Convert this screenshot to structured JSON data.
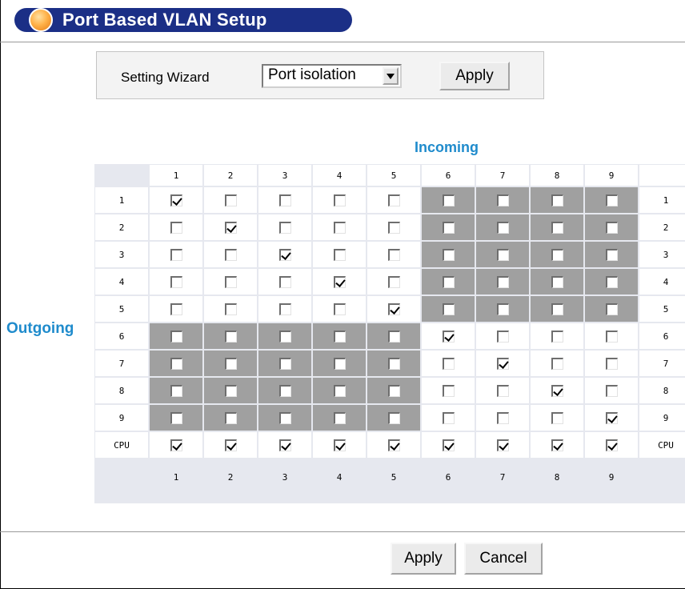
{
  "page": {
    "title": "Port Based VLAN Setup"
  },
  "wizard": {
    "label": "Setting Wizard",
    "selected": "Port isolation",
    "apply_label": "Apply"
  },
  "matrix": {
    "incoming_label": "Incoming",
    "outgoing_label": "Outgoing",
    "columns": [
      "1",
      "2",
      "3",
      "4",
      "5",
      "6",
      "7",
      "8",
      "9"
    ],
    "rows": [
      "1",
      "2",
      "3",
      "4",
      "5",
      "6",
      "7",
      "8",
      "9",
      "CPU"
    ],
    "checked": [
      [
        1,
        0,
        0,
        0,
        0,
        0,
        0,
        0,
        0
      ],
      [
        0,
        1,
        0,
        0,
        0,
        0,
        0,
        0,
        0
      ],
      [
        0,
        0,
        1,
        0,
        0,
        0,
        0,
        0,
        0
      ],
      [
        0,
        0,
        0,
        1,
        0,
        0,
        0,
        0,
        0
      ],
      [
        0,
        0,
        0,
        0,
        1,
        0,
        0,
        0,
        0
      ],
      [
        0,
        0,
        0,
        0,
        0,
        1,
        0,
        0,
        0
      ],
      [
        0,
        0,
        0,
        0,
        0,
        0,
        1,
        0,
        0
      ],
      [
        0,
        0,
        0,
        0,
        0,
        0,
        0,
        1,
        0
      ],
      [
        0,
        0,
        0,
        0,
        0,
        0,
        0,
        0,
        1
      ],
      [
        1,
        1,
        1,
        1,
        1,
        1,
        1,
        1,
        1
      ]
    ],
    "shaded": [
      [
        0,
        0,
        0,
        0,
        0,
        1,
        1,
        1,
        1
      ],
      [
        0,
        0,
        0,
        0,
        0,
        1,
        1,
        1,
        1
      ],
      [
        0,
        0,
        0,
        0,
        0,
        1,
        1,
        1,
        1
      ],
      [
        0,
        0,
        0,
        0,
        0,
        1,
        1,
        1,
        1
      ],
      [
        0,
        0,
        0,
        0,
        0,
        1,
        1,
        1,
        1
      ],
      [
        1,
        1,
        1,
        1,
        1,
        0,
        0,
        0,
        0
      ],
      [
        1,
        1,
        1,
        1,
        1,
        0,
        0,
        0,
        0
      ],
      [
        1,
        1,
        1,
        1,
        1,
        0,
        0,
        0,
        0
      ],
      [
        1,
        1,
        1,
        1,
        1,
        0,
        0,
        0,
        0
      ],
      [
        0,
        0,
        0,
        0,
        0,
        0,
        0,
        0,
        0
      ]
    ]
  },
  "footer": {
    "apply_label": "Apply",
    "cancel_label": "Cancel"
  },
  "colors": {
    "title_bar": "#1b2f86",
    "label_accent": "#1f8bcc",
    "shaded_cell": "#a0a0a0",
    "grid_line": "#e6e8ef"
  }
}
